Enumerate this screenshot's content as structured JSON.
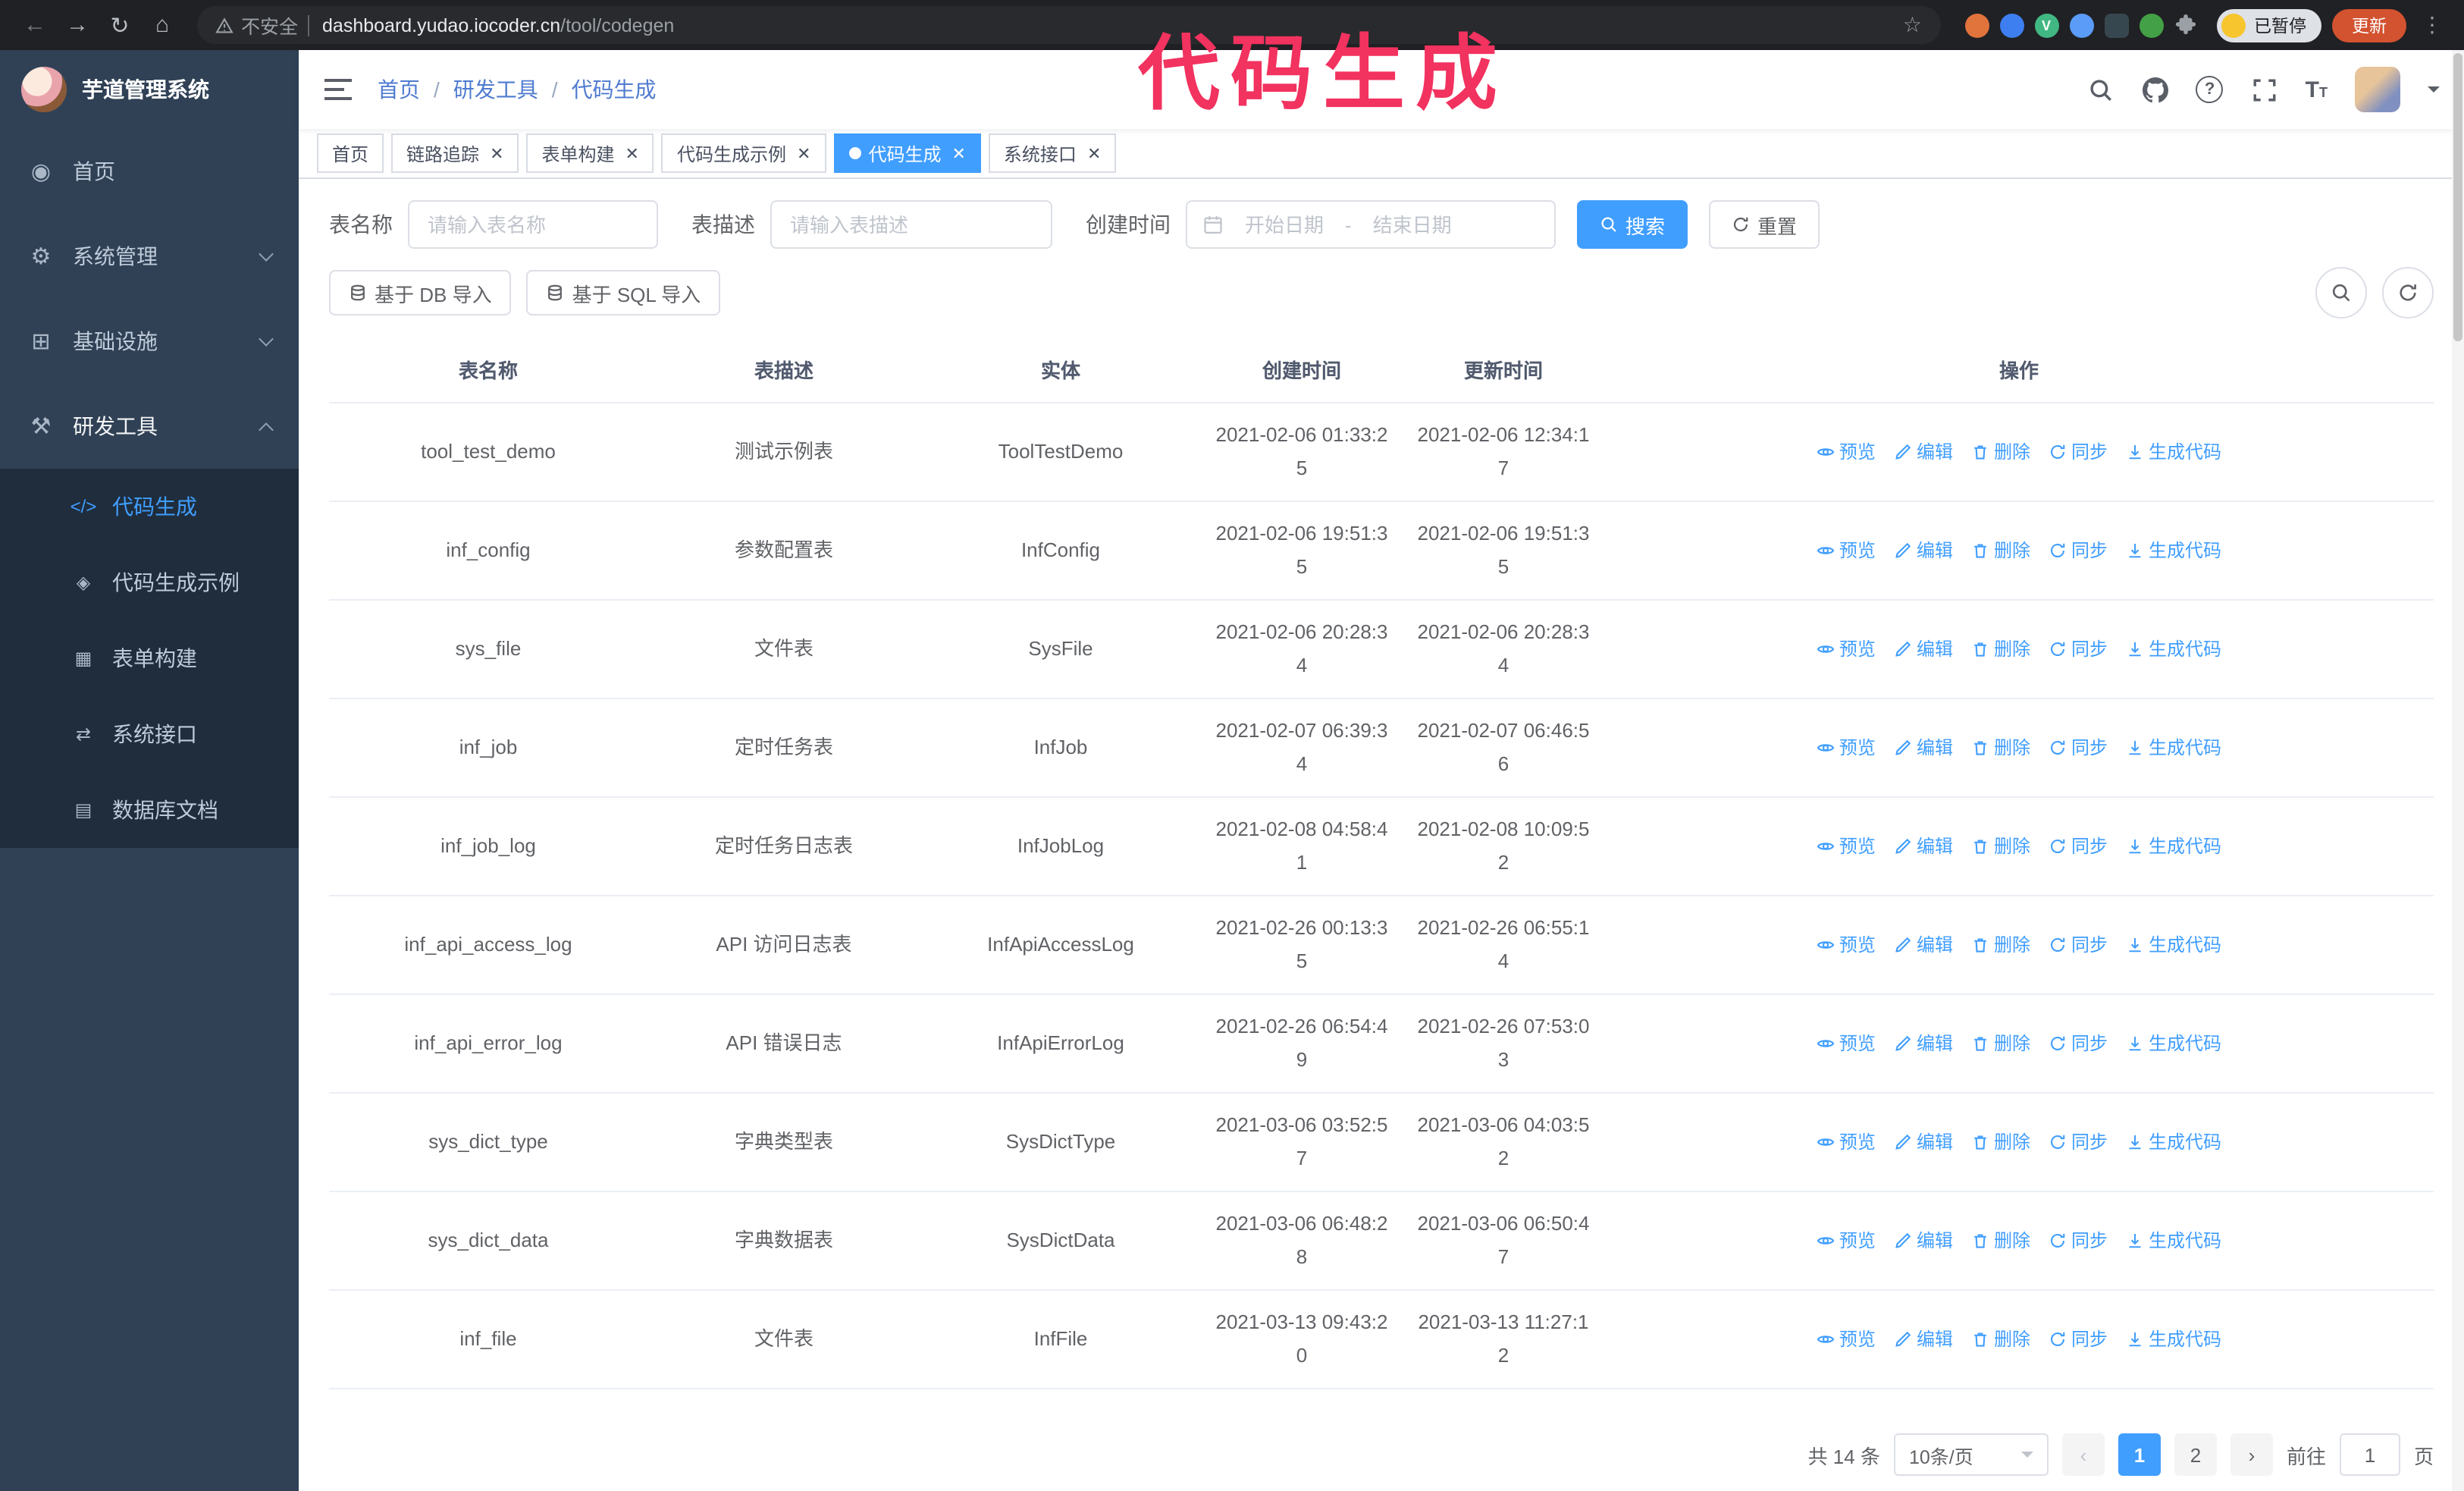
{
  "annotation": {
    "text": "代码生成",
    "color": "#f2325f"
  },
  "browser": {
    "security_label": "不安全",
    "url_host": "dashboard.yudao.iocoder.cn",
    "url_path": "/tool/codegen",
    "paused_badge": "已暂停",
    "update_button": "更新",
    "nav_icons": [
      "back-icon",
      "forward-icon",
      "reload-icon",
      "home-icon",
      "star-icon",
      "extensions-puzzle-icon",
      "kebab-menu-icon"
    ]
  },
  "sidebar": {
    "app_title": "芋道管理系统",
    "items": [
      {
        "label": "首页",
        "icon": "home-icon",
        "expandable": false
      },
      {
        "label": "系统管理",
        "icon": "gear-icon",
        "expandable": true
      },
      {
        "label": "基础设施",
        "icon": "infrastructure-icon",
        "expandable": true
      },
      {
        "label": "研发工具",
        "icon": "tools-icon",
        "expandable": true,
        "expanded": true
      }
    ],
    "submenu": [
      {
        "label": "代码生成",
        "icon": "code-icon",
        "active": true
      },
      {
        "label": "代码生成示例",
        "icon": "example-icon",
        "active": false
      },
      {
        "label": "表单构建",
        "icon": "form-builder-icon",
        "active": false
      },
      {
        "label": "系统接口",
        "icon": "api-icon",
        "active": false
      },
      {
        "label": "数据库文档",
        "icon": "db-doc-icon",
        "active": false
      }
    ]
  },
  "header": {
    "breadcrumb": [
      "首页",
      "研发工具",
      "代码生成"
    ],
    "right_icons": [
      "search-icon",
      "github-icon",
      "help-icon",
      "fullscreen-icon",
      "font-size-icon",
      "avatar",
      "caret-down-icon"
    ]
  },
  "tabs": [
    {
      "label": "首页",
      "active": false,
      "closable": false
    },
    {
      "label": "链路追踪",
      "active": false,
      "closable": true
    },
    {
      "label": "表单构建",
      "active": false,
      "closable": true
    },
    {
      "label": "代码生成示例",
      "active": false,
      "closable": true
    },
    {
      "label": "代码生成",
      "active": true,
      "closable": true
    },
    {
      "label": "系统接口",
      "active": false,
      "closable": true
    }
  ],
  "filters": {
    "table_name_label": "表名称",
    "table_name_placeholder": "请输入表名称",
    "table_desc_label": "表描述",
    "table_desc_placeholder": "请输入表描述",
    "create_time_label": "创建时间",
    "date_start_placeholder": "开始日期",
    "date_separator": "-",
    "date_end_placeholder": "结束日期",
    "search_button": "搜索",
    "reset_button": "重置"
  },
  "toolbar": {
    "import_db_button": "基于 DB 导入",
    "import_sql_button": "基于 SQL 导入",
    "right_icons": [
      "search-icon",
      "refresh-icon"
    ]
  },
  "table": {
    "columns": [
      "表名称",
      "表描述",
      "实体",
      "创建时间",
      "更新时间",
      "操作"
    ],
    "actions": [
      {
        "key": "preview",
        "label": "预览",
        "icon": "eye-icon"
      },
      {
        "key": "edit",
        "label": "编辑",
        "icon": "edit-icon"
      },
      {
        "key": "delete",
        "label": "删除",
        "icon": "delete-icon"
      },
      {
        "key": "sync",
        "label": "同步",
        "icon": "sync-icon"
      },
      {
        "key": "generate",
        "label": "生成代码",
        "icon": "download-icon"
      }
    ],
    "rows": [
      {
        "name": "tool_test_demo",
        "desc": "测试示例表",
        "entity": "ToolTestDemo",
        "created": "2021-02-06 01:33:25",
        "updated": "2021-02-06 12:34:17"
      },
      {
        "name": "inf_config",
        "desc": "参数配置表",
        "entity": "InfConfig",
        "created": "2021-02-06 19:51:35",
        "updated": "2021-02-06 19:51:35"
      },
      {
        "name": "sys_file",
        "desc": "文件表",
        "entity": "SysFile",
        "created": "2021-02-06 20:28:34",
        "updated": "2021-02-06 20:28:34"
      },
      {
        "name": "inf_job",
        "desc": "定时任务表",
        "entity": "InfJob",
        "created": "2021-02-07 06:39:34",
        "updated": "2021-02-07 06:46:56"
      },
      {
        "name": "inf_job_log",
        "desc": "定时任务日志表",
        "entity": "InfJobLog",
        "created": "2021-02-08 04:58:41",
        "updated": "2021-02-08 10:09:52"
      },
      {
        "name": "inf_api_access_log",
        "desc": "API 访问日志表",
        "entity": "InfApiAccessLog",
        "created": "2021-02-26 00:13:35",
        "updated": "2021-02-26 06:55:14"
      },
      {
        "name": "inf_api_error_log",
        "desc": "API 错误日志",
        "entity": "InfApiErrorLog",
        "created": "2021-02-26 06:54:49",
        "updated": "2021-02-26 07:53:03"
      },
      {
        "name": "sys_dict_type",
        "desc": "字典类型表",
        "entity": "SysDictType",
        "created": "2021-03-06 03:52:57",
        "updated": "2021-03-06 04:03:52"
      },
      {
        "name": "sys_dict_data",
        "desc": "字典数据表",
        "entity": "SysDictData",
        "created": "2021-03-06 06:48:28",
        "updated": "2021-03-06 06:50:47"
      },
      {
        "name": "inf_file",
        "desc": "文件表",
        "entity": "InfFile",
        "created": "2021-03-13 09:43:20",
        "updated": "2021-03-13 11:27:12"
      }
    ]
  },
  "pagination": {
    "total_text": "共 14 条",
    "page_size": "10条/页",
    "prev": "‹",
    "pages": [
      "1",
      "2"
    ],
    "next": "›",
    "current_page": "1",
    "goto_label": "前往",
    "goto_value": "1",
    "goto_suffix": "页"
  },
  "colors": {
    "accent": "#409eff",
    "sidebar_bg": "#304156",
    "submenu_bg": "#1f2d3d",
    "chrome_bg": "#202124",
    "annotation": "#f2325f",
    "update_button_bg": "#d35230"
  }
}
